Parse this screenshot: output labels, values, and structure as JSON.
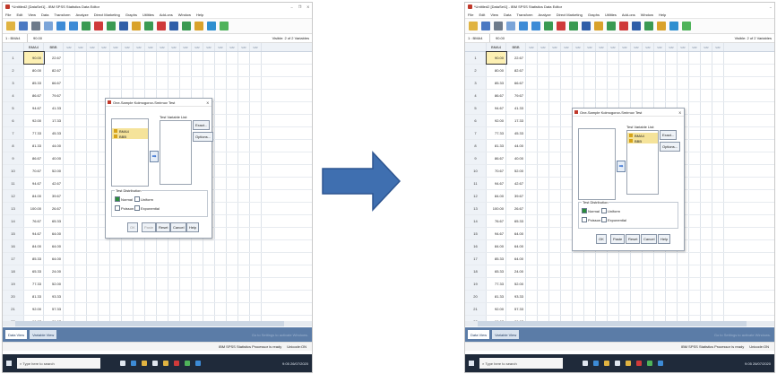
{
  "window": {
    "title": "*Untitled2 [DataSet1] - IBM SPSS Statistics Data Editor",
    "controls": [
      "–",
      "❐",
      "X"
    ]
  },
  "menu": [
    "File",
    "Edit",
    "View",
    "Data",
    "Transform",
    "Analyze",
    "Direct Marketing",
    "Graphs",
    "Utilities",
    "Add-ons",
    "Window",
    "Help"
  ],
  "cellbar": {
    "ref": "1 : BMA4",
    "value": "90.00",
    "visible": "Visible: 2 of 2 Variables"
  },
  "columns": [
    "BMA4",
    "BBB",
    "var",
    "var",
    "var",
    "var",
    "var",
    "var",
    "var",
    "var",
    "var",
    "var",
    "var",
    "var",
    "var",
    "var",
    "var",
    "var",
    "var"
  ],
  "rows": [
    [
      "1",
      "90.00",
      "22.67"
    ],
    [
      "2",
      "80.00",
      "82.67"
    ],
    [
      "3",
      "85.33",
      "66.67"
    ],
    [
      "4",
      "86.67",
      "79.67"
    ],
    [
      "5",
      "94.67",
      "41.33"
    ],
    [
      "6",
      "92.00",
      "17.33"
    ],
    [
      "7",
      "77.33",
      "45.33"
    ],
    [
      "8",
      "81.33",
      "44.00"
    ],
    [
      "9",
      "86.67",
      "40.00"
    ],
    [
      "10",
      "70.67",
      "52.00"
    ],
    [
      "11",
      "94.67",
      "42.67"
    ],
    [
      "12",
      "84.00",
      "39.67"
    ],
    [
      "13",
      "100.00",
      "26.67"
    ],
    [
      "14",
      "76.67",
      "65.33"
    ],
    [
      "15",
      "94.67",
      "64.00"
    ],
    [
      "16",
      "84.00",
      "64.00"
    ],
    [
      "17",
      "85.33",
      "64.00"
    ],
    [
      "18",
      "65.33",
      "24.00"
    ],
    [
      "19",
      "77.33",
      "52.00"
    ],
    [
      "20",
      "81.33",
      "93.33"
    ],
    [
      "21",
      "92.00",
      "57.33"
    ],
    [
      "22",
      "66.67",
      "86.67"
    ],
    [
      "23",
      "100.00",
      "90"
    ]
  ],
  "tabs": {
    "data_view": "Data View",
    "variable_view": "Variable View"
  },
  "watermark": "Go to Settings to activate Windows.",
  "status": {
    "processor": "IBM SPSS Statistics Processor is ready",
    "unicode": "Unicode:ON"
  },
  "taskbar": {
    "search_placeholder": "Type here to search",
    "time": "9:05",
    "date": "26/07/2020"
  },
  "dialog": {
    "title": "One-Sample Kolmogorov-Smirnov Test",
    "close": "X",
    "test_variable_label": "Test Variable List:",
    "variables": [
      "BMA4",
      "BBB"
    ],
    "buttons": {
      "exact": "Exact...",
      "options": "Options..."
    },
    "distribution_label": "Test Distribution",
    "distributions": [
      "Normal",
      "Uniform",
      "Poisson",
      "Exponential"
    ],
    "bottom_buttons": [
      "OK",
      "Paste",
      "Reset",
      "Cancel",
      "Help"
    ]
  },
  "colors": {
    "accent": "#5b7ca7",
    "selection": "#f5e39a",
    "arrow": "#3f6fb0"
  }
}
